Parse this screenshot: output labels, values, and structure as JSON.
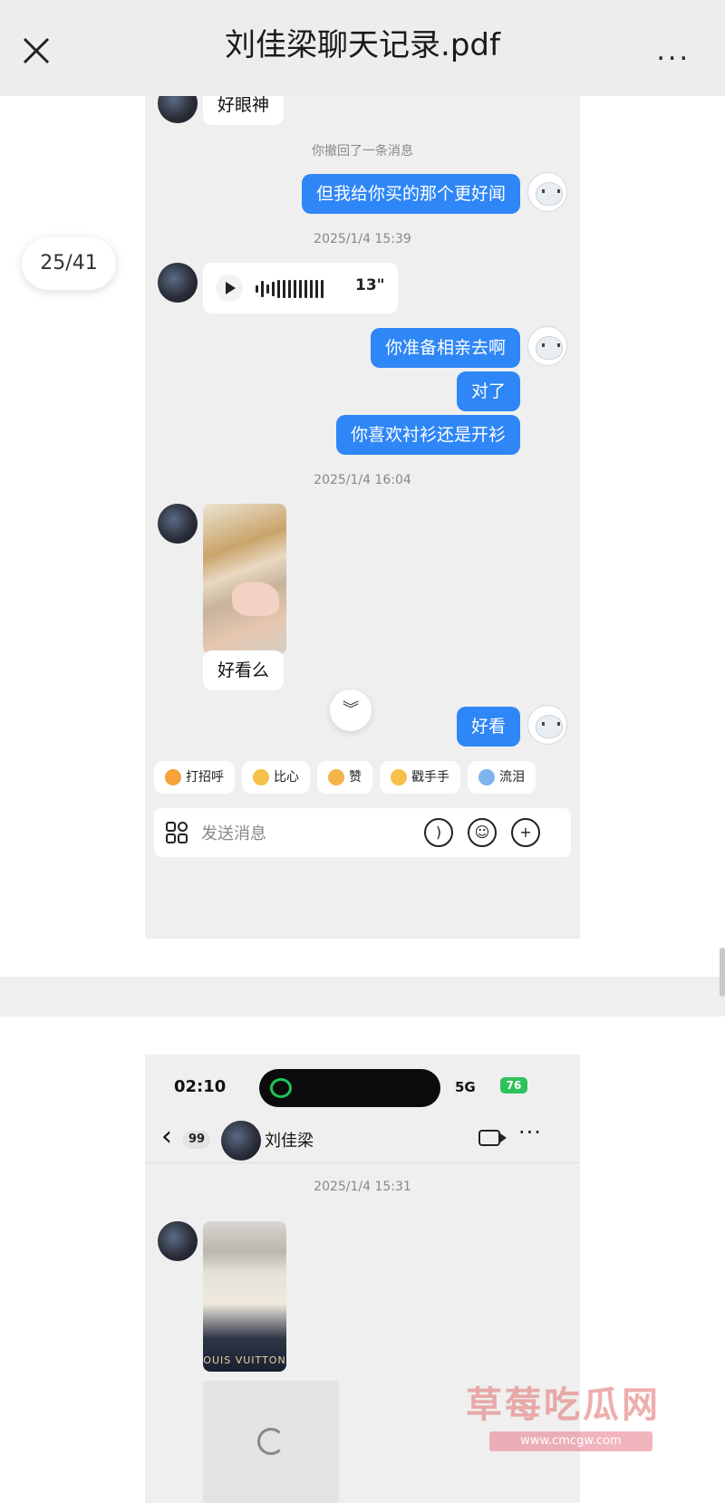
{
  "viewer": {
    "title": "刘佳梁聊天记录.pdf",
    "page_counter": "25/41",
    "more_glyph": "...",
    "close_icon": "close-icon"
  },
  "page1_chat": {
    "top_partial_bubble": "好眼神",
    "recall_notice": "你撤回了一条消息",
    "messages": {
      "out1": "但我给你买的那个更好闻",
      "ts1": "2025/1/4 15:39",
      "voice_duration": "13\"",
      "out2": "你准备相亲去啊",
      "out3": "对了",
      "out4": "你喜欢衬衫还是开衫",
      "ts2": "2025/1/4 16:04",
      "in_caption": "好看么",
      "out5": "好看"
    },
    "reactions": [
      "打招呼",
      "比心",
      "赞",
      "戳手手",
      "流泪"
    ],
    "input_placeholder": "发送消息",
    "scroll_down_glyph": "︾"
  },
  "page2_chat": {
    "status_time": "02:10",
    "network": "5G",
    "battery": "76",
    "back_glyph": "‹",
    "unread_count": "99",
    "contact_name": "刘佳梁",
    "timestamp": "2025/1/4 15:31",
    "photo_brand_text": "OUIS VUITTON",
    "more_glyph": "···"
  },
  "watermark": {
    "text": "草莓吃瓜网",
    "url": "www.cmcgw.com"
  }
}
